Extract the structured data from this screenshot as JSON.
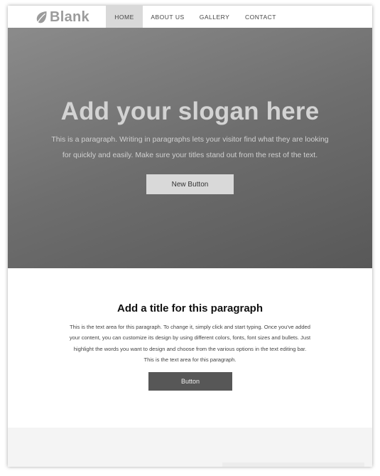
{
  "brand": {
    "name": "Blank",
    "color": "#9b9b9b"
  },
  "nav": {
    "items": [
      {
        "label": "HOME",
        "active": true
      },
      {
        "label": "ABOUT US",
        "active": false
      },
      {
        "label": "GALLERY",
        "active": false
      },
      {
        "label": "CONTACT",
        "active": false
      }
    ]
  },
  "hero": {
    "title": "Add your slogan here",
    "paragraph": "This is a paragraph. Writing in paragraphs lets your visitor find what they are looking for quickly and easily. Make sure your titles stand out from the rest of the text.",
    "button_label": "New Button"
  },
  "section": {
    "title": "Add a title for this paragraph",
    "paragraph": "This is the text area for this paragraph. To change it, simply click and start typing. Once you've added your content, you can customize its design by using different colors, fonts, font sizes and bullets. Just highlight the words you want to design and choose from the various options in the text editing bar. This is the text area for this paragraph.",
    "button_label": "Button"
  },
  "colors": {
    "nav_active_bg": "#d9d9d9",
    "hero_button_bg": "#d9d9d9",
    "section_button_bg": "#575757",
    "footer_bg": "#f4f4f4"
  }
}
